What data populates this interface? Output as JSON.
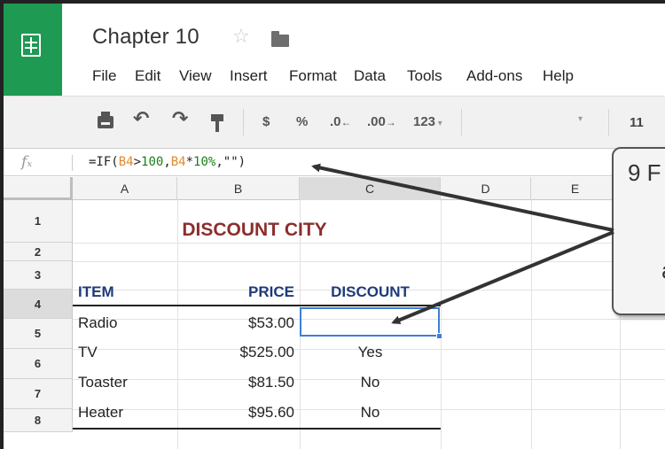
{
  "app": {
    "title": "Chapter 10"
  },
  "menu": [
    "File",
    "Edit",
    "View",
    "Insert",
    "Format",
    "Data",
    "Tools",
    "Add-ons",
    "Help"
  ],
  "toolbar": {
    "currency": "$",
    "percent": "%",
    "decrease_decimals": ".0",
    "increase_decimals": ".00",
    "more_formats": "123",
    "font_size": "11"
  },
  "formula_bar": {
    "fx": "fx",
    "formula_parts": [
      {
        "text": "=IF(",
        "kind": "plain"
      },
      {
        "text": "B4",
        "kind": "ref"
      },
      {
        "text": ">",
        "kind": "plain"
      },
      {
        "text": "100",
        "kind": "num"
      },
      {
        "text": ",",
        "kind": "plain"
      },
      {
        "text": "B4",
        "kind": "ref"
      },
      {
        "text": "*",
        "kind": "plain"
      },
      {
        "text": "10%",
        "kind": "num"
      },
      {
        "text": ",\"\")",
        "kind": "plain"
      }
    ]
  },
  "columns": [
    "A",
    "B",
    "C",
    "D",
    "E"
  ],
  "rows": [
    "1",
    "2",
    "3",
    "4",
    "5",
    "6",
    "7",
    "8"
  ],
  "sheet": {
    "title": "DISCOUNT CITY",
    "headers": {
      "item": "ITEM",
      "price": "PRICE",
      "discount": "DISCOUNT"
    },
    "data": [
      {
        "item": "Radio",
        "price": "$53.00",
        "discount": ""
      },
      {
        "item": "TV",
        "price": "$525.00",
        "discount": "Yes"
      },
      {
        "item": "Toaster",
        "price": "$81.50",
        "discount": "No"
      },
      {
        "item": "Heater",
        "price": "$95.60",
        "discount": "No"
      }
    ]
  },
  "callout": {
    "line1": "9 F",
    "line2": "a"
  },
  "colors": {
    "brand_green": "#1e9a52",
    "title_red": "#8b2e2e",
    "header_blue": "#1f3a7a",
    "selection_blue": "#3f7ed8",
    "formula_ref": "#e08a2e",
    "formula_num": "#1a7f1a"
  }
}
